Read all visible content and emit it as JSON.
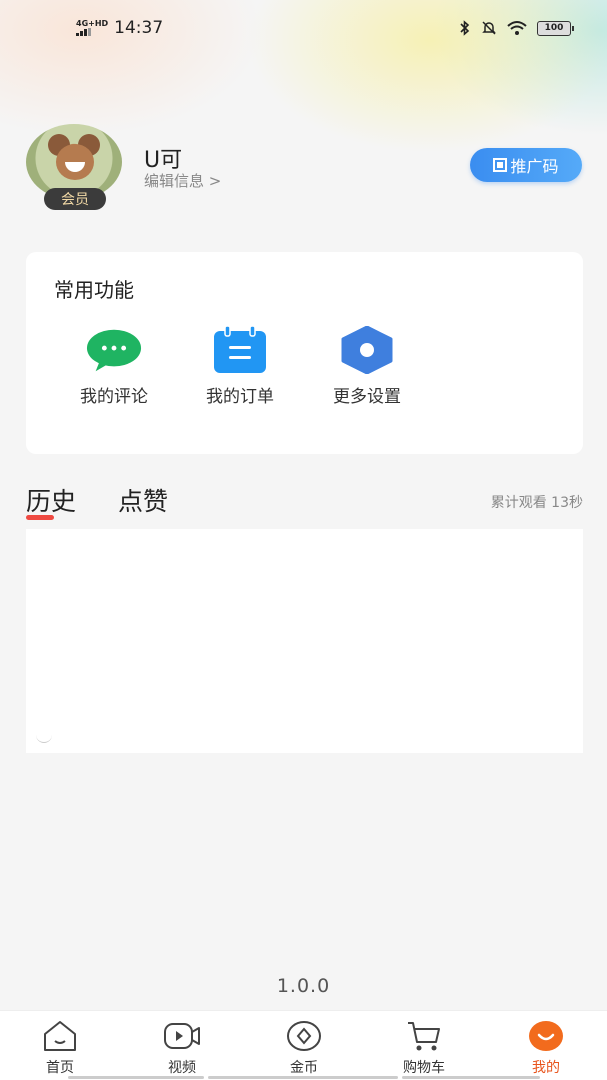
{
  "status_bar": {
    "network": "4G+HD",
    "time": "14:37",
    "battery": "100"
  },
  "profile": {
    "username": "U可",
    "edit_link": "编辑信息 >",
    "vip_badge": "会员",
    "promo_button": "推广码"
  },
  "functions": {
    "title": "常用功能",
    "items": [
      {
        "label": "我的评论",
        "icon": "comment-bubble-icon",
        "color": "#1fb462"
      },
      {
        "label": "我的订单",
        "icon": "order-clipboard-icon",
        "color": "#2196f3"
      },
      {
        "label": "更多设置",
        "icon": "settings-hexagon-icon",
        "color": "#3f7fde"
      }
    ]
  },
  "history": {
    "tabs": [
      "历史",
      "点赞"
    ],
    "active_tab": "历史",
    "watch_total": "累计观看 13秒"
  },
  "version": "1.0.0",
  "bottom_nav": {
    "items": [
      {
        "label": "首页",
        "icon": "home-icon"
      },
      {
        "label": "视频",
        "icon": "video-icon"
      },
      {
        "label": "金币",
        "icon": "coin-icon"
      },
      {
        "label": "购物车",
        "icon": "cart-icon"
      },
      {
        "label": "我的",
        "icon": "profile-icon"
      }
    ],
    "active": "我的"
  },
  "colors": {
    "accent": "#e8541c",
    "tab_underline": "#ef4a42",
    "promo_blue": "#3a8df0"
  }
}
